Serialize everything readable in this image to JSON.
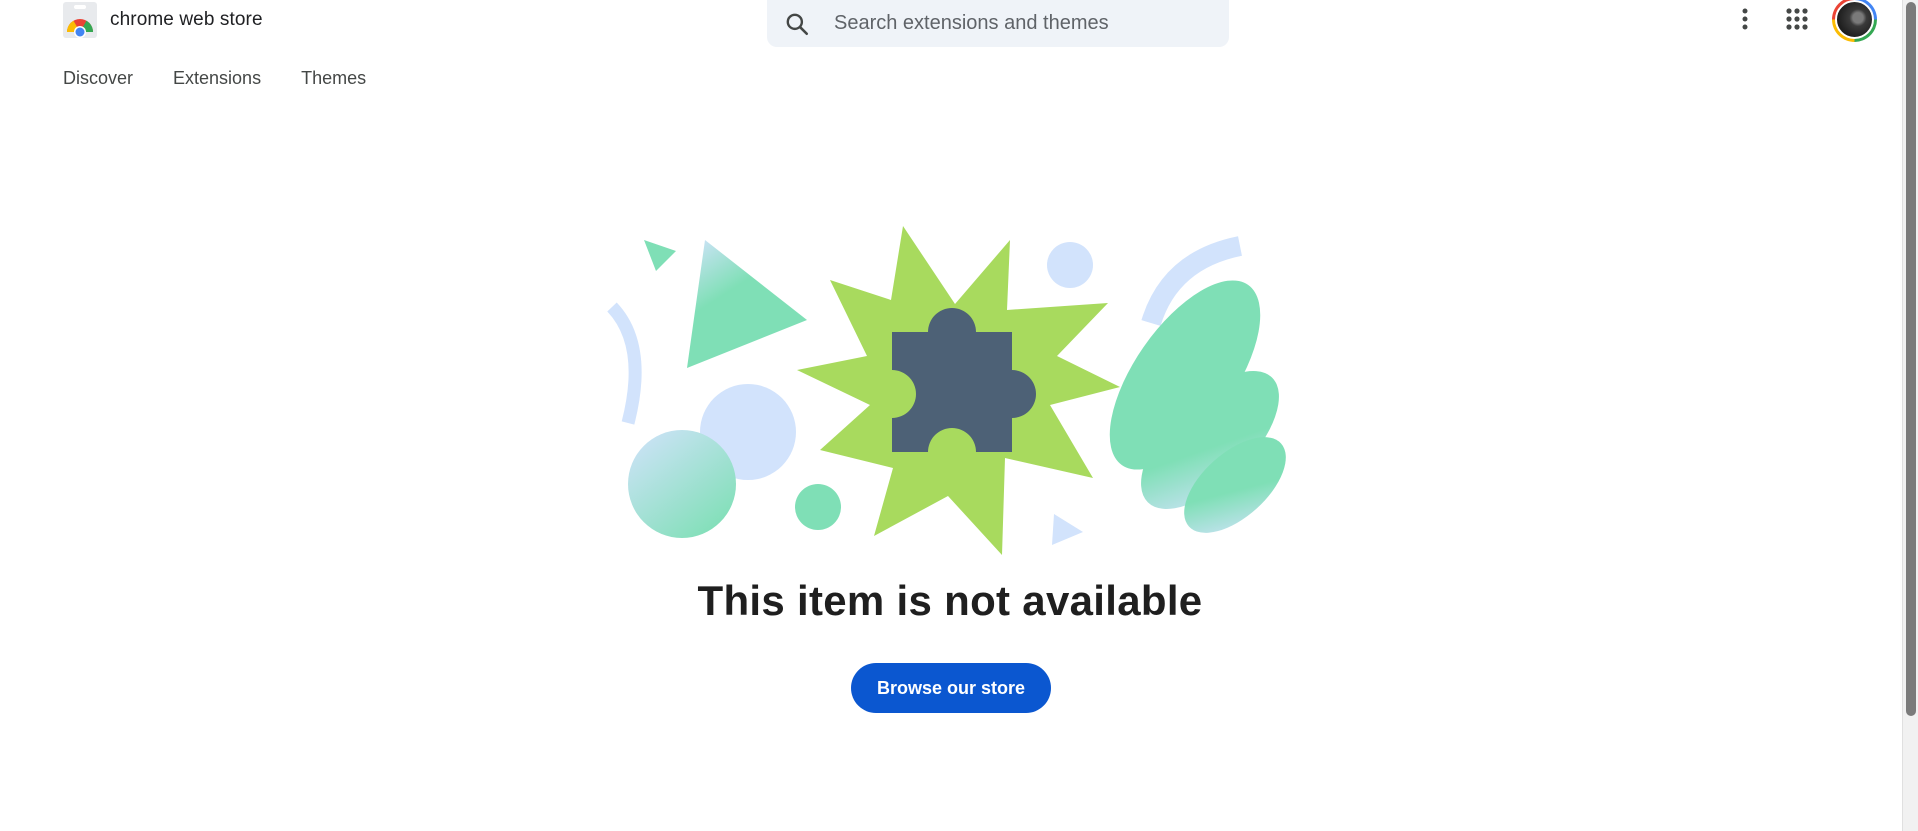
{
  "header": {
    "logo_text": "chrome web store",
    "search": {
      "placeholder": "Search extensions and themes",
      "value": ""
    },
    "icons": {
      "search": "search-icon",
      "more": "more-vert-icon",
      "apps": "apps-grid-icon",
      "avatar": "account-avatar"
    }
  },
  "nav": {
    "items": [
      {
        "label": "Discover"
      },
      {
        "label": "Extensions"
      },
      {
        "label": "Themes"
      }
    ]
  },
  "main": {
    "headline": "This item is not available",
    "browse_label": "Browse our store"
  },
  "colors": {
    "accent": "#0b57d0",
    "starburst": "#a8da5e",
    "puzzle": "#4d6176",
    "mint": "#7fdfb6",
    "pale_blue": "#d2e3fc",
    "search_bg": "#eff3f8"
  }
}
